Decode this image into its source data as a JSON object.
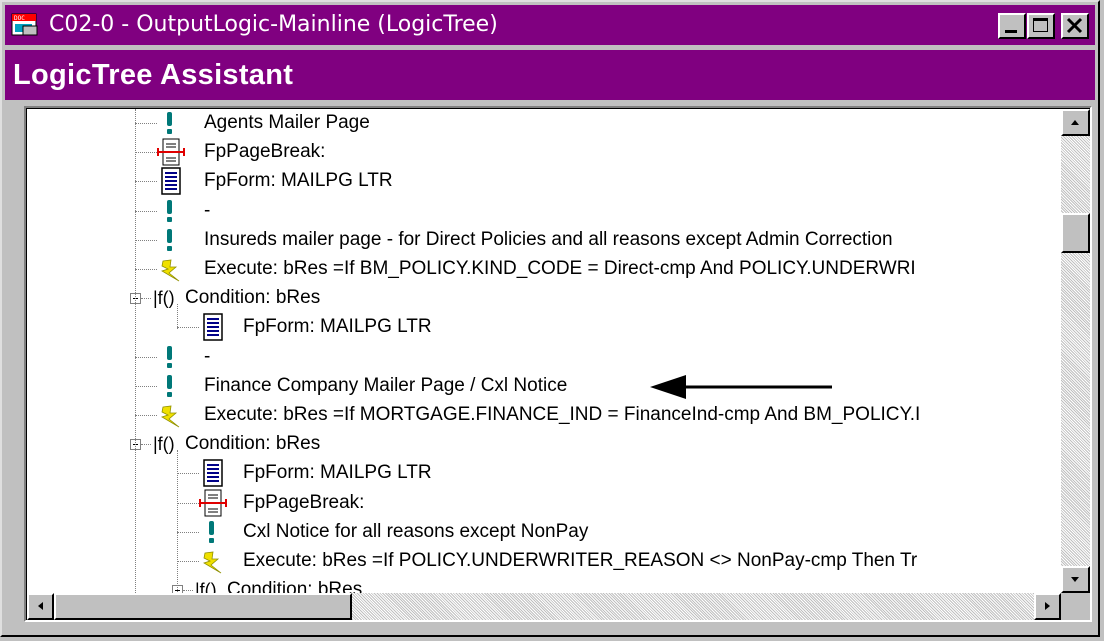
{
  "window": {
    "title": "C02-0 - OutputLogic-Mainline (LogicTree)",
    "icon": "doc-icon",
    "controls": [
      "minimize-icon",
      "maximize-icon",
      "close-icon"
    ]
  },
  "header": {
    "title": "LogicTree Assistant"
  },
  "tree": {
    "items": [
      {
        "label": "Agents Mailer Page",
        "icon": "comment-icon"
      },
      {
        "label": "FpPageBreak:",
        "icon": "page-break-icon"
      },
      {
        "label": "FpForm: MAILPG LTR",
        "icon": "form-icon"
      },
      {
        "label": "-",
        "icon": "comment-icon"
      },
      {
        "label": "Insureds mailer page - for Direct Policies and all reasons except Admin Correction",
        "icon": "comment-icon"
      },
      {
        "label": "Execute: bRes =If BM_POLICY.KIND_CODE = Direct-cmp And POLICY.UNDERWRI",
        "icon": "execute-icon"
      },
      {
        "label": "Condition: bRes",
        "icon": "condition-icon",
        "prefix": "|f()"
      },
      {
        "label": "FpForm: MAILPG LTR",
        "icon": "form-icon"
      },
      {
        "label": "-",
        "icon": "comment-icon"
      },
      {
        "label": "Finance Company Mailer Page / Cxl Notice",
        "icon": "comment-icon"
      },
      {
        "label": "Execute: bRes =If MORTGAGE.FINANCE_IND = FinanceInd-cmp And BM_POLICY.I",
        "icon": "execute-icon"
      },
      {
        "label": "Condition: bRes",
        "icon": "condition-icon",
        "prefix": "|f()"
      },
      {
        "label": "FpForm: MAILPG LTR",
        "icon": "form-icon"
      },
      {
        "label": "FpPageBreak:",
        "icon": "page-break-icon"
      },
      {
        "label": "Cxl Notice for all reasons except NonPay",
        "icon": "comment-icon"
      },
      {
        "label": "Execute: bRes =If POLICY.UNDERWRITER_REASON <> NonPay-cmp Then Tr",
        "icon": "execute-icon"
      },
      {
        "label": "Condition: bRes",
        "icon": "condition-icon",
        "prefix": "|f()"
      }
    ]
  },
  "annotation": {
    "icon": "arrow-left-icon"
  },
  "colors": {
    "titlebar": "#800080",
    "face": "#c0c0c0",
    "panel": "#ffffff"
  }
}
